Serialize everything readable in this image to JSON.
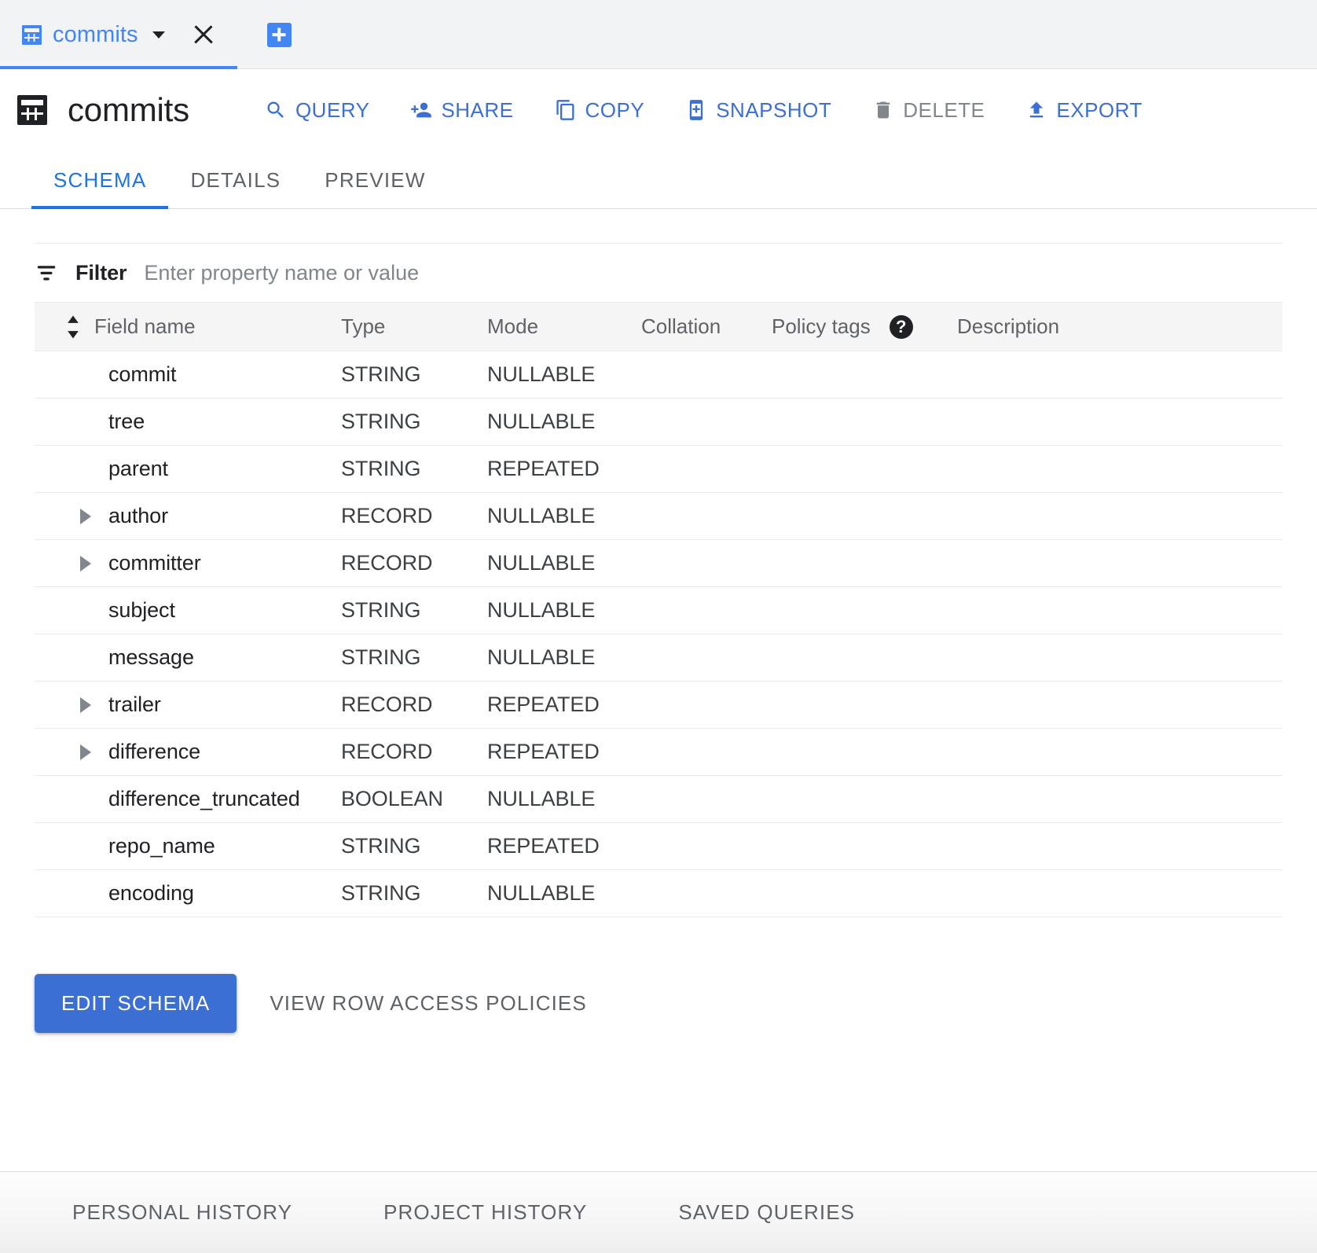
{
  "tabstrip": {
    "tab_label": "commits",
    "tab_icon": "table-icon",
    "caret_icon": "chevron-down-icon",
    "close_icon": "close-icon",
    "new_tab_icon": "plus-icon"
  },
  "header": {
    "icon": "table-icon",
    "title": "commits",
    "toolbar": [
      {
        "label": "QUERY",
        "icon": "search-icon",
        "disabled": false
      },
      {
        "label": "SHARE",
        "icon": "person-add-icon",
        "disabled": false
      },
      {
        "label": "COPY",
        "icon": "copy-icon",
        "disabled": false
      },
      {
        "label": "SNAPSHOT",
        "icon": "snapshot-icon",
        "disabled": false
      },
      {
        "label": "DELETE",
        "icon": "trash-icon",
        "disabled": true
      },
      {
        "label": "EXPORT",
        "icon": "upload-icon",
        "disabled": false
      }
    ]
  },
  "view_tabs": [
    {
      "label": "SCHEMA",
      "active": true
    },
    {
      "label": "DETAILS",
      "active": false
    },
    {
      "label": "PREVIEW",
      "active": false
    }
  ],
  "filter": {
    "icon": "filter-icon",
    "label": "Filter",
    "value": "",
    "placeholder": "Enter property name or value"
  },
  "schema_table": {
    "sort_icon": "sort-arrows-icon",
    "policy_tags_help_icon": "help-icon",
    "columns": [
      "Field name",
      "Type",
      "Mode",
      "Collation",
      "Policy tags",
      "Description"
    ],
    "rows": [
      {
        "expandable": false,
        "field": "commit",
        "type": "STRING",
        "mode": "NULLABLE",
        "collation": "",
        "policy_tags": "",
        "description": ""
      },
      {
        "expandable": false,
        "field": "tree",
        "type": "STRING",
        "mode": "NULLABLE",
        "collation": "",
        "policy_tags": "",
        "description": ""
      },
      {
        "expandable": false,
        "field": "parent",
        "type": "STRING",
        "mode": "REPEATED",
        "collation": "",
        "policy_tags": "",
        "description": ""
      },
      {
        "expandable": true,
        "field": "author",
        "type": "RECORD",
        "mode": "NULLABLE",
        "collation": "",
        "policy_tags": "",
        "description": ""
      },
      {
        "expandable": true,
        "field": "committer",
        "type": "RECORD",
        "mode": "NULLABLE",
        "collation": "",
        "policy_tags": "",
        "description": ""
      },
      {
        "expandable": false,
        "field": "subject",
        "type": "STRING",
        "mode": "NULLABLE",
        "collation": "",
        "policy_tags": "",
        "description": ""
      },
      {
        "expandable": false,
        "field": "message",
        "type": "STRING",
        "mode": "NULLABLE",
        "collation": "",
        "policy_tags": "",
        "description": ""
      },
      {
        "expandable": true,
        "field": "trailer",
        "type": "RECORD",
        "mode": "REPEATED",
        "collation": "",
        "policy_tags": "",
        "description": ""
      },
      {
        "expandable": true,
        "field": "difference",
        "type": "RECORD",
        "mode": "REPEATED",
        "collation": "",
        "policy_tags": "",
        "description": ""
      },
      {
        "expandable": false,
        "field": "difference_truncated",
        "type": "BOOLEAN",
        "mode": "NULLABLE",
        "collation": "",
        "policy_tags": "",
        "description": ""
      },
      {
        "expandable": false,
        "field": "repo_name",
        "type": "STRING",
        "mode": "REPEATED",
        "collation": "",
        "policy_tags": "",
        "description": ""
      },
      {
        "expandable": false,
        "field": "encoding",
        "type": "STRING",
        "mode": "NULLABLE",
        "collation": "",
        "policy_tags": "",
        "description": ""
      }
    ]
  },
  "actions": {
    "edit_schema_label": "EDIT SCHEMA",
    "view_row_access_policies_label": "VIEW ROW ACCESS POLICIES"
  },
  "bottom_bar": [
    {
      "label": "PERSONAL HISTORY"
    },
    {
      "label": "PROJECT HISTORY"
    },
    {
      "label": "SAVED QUERIES"
    }
  ],
  "colors": {
    "accent_blue": "#4285f4",
    "link_blue": "#3c6fd3",
    "active_tab_blue": "#1a73e8",
    "primary_button": "#3b6fd4",
    "disabled_grey": "#80868b",
    "text_primary": "#202124",
    "text_secondary": "#5f6368",
    "tabstrip_bg": "#f1f3f4",
    "table_head_bg": "#f5f5f5"
  }
}
